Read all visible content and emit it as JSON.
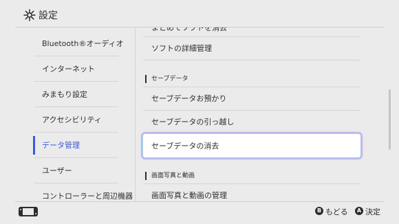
{
  "header": {
    "title": "設定",
    "icon": "gear-icon"
  },
  "sidebar": {
    "items": [
      {
        "label": "Bluetooth®オーディオ"
      },
      {
        "label": "インターネット"
      },
      {
        "label": "みまもり設定"
      },
      {
        "label": "アクセシビリティ"
      },
      {
        "label": "データ管理"
      },
      {
        "label": "ユーザー"
      },
      {
        "label": "コントローラーと周辺機器"
      }
    ],
    "active_index": 4
  },
  "content": {
    "partial_top_label": "まとめてソフトを消去",
    "software_detail_label": "ソフトの詳細管理",
    "section_save": "セーブデータ",
    "save_items": [
      {
        "label": "セーブデータお預かり"
      },
      {
        "label": "セーブデータの引っ越し"
      },
      {
        "label": "セーブデータの消去"
      }
    ],
    "selected_label": "セーブデータの消去",
    "section_screenshot": "画面写真と動画",
    "screenshot_manage_label": "画面写真と動画の管理"
  },
  "footer": {
    "back": {
      "button": "B",
      "label": "もどる"
    },
    "ok": {
      "button": "A",
      "label": "決定"
    }
  },
  "colors": {
    "accent": "#3a5ad8",
    "background": "#ebebeb",
    "text": "#2d2d2d"
  }
}
